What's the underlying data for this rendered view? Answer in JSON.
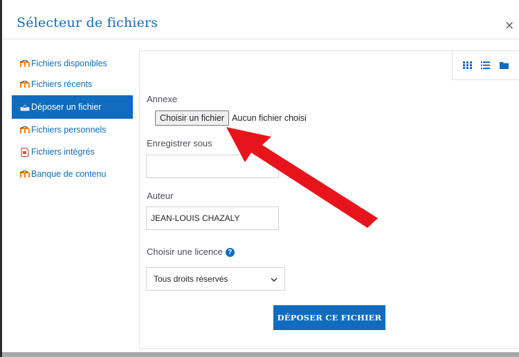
{
  "dialog": {
    "title": "Sélecteur de fichiers",
    "close_label": "×"
  },
  "sidebar": {
    "items": [
      {
        "label": "Fichiers disponibles",
        "icon": "moodle-icon",
        "active": false
      },
      {
        "label": "Fichiers récents",
        "icon": "moodle-icon",
        "active": false
      },
      {
        "label": "Déposer un fichier",
        "icon": "upload-icon",
        "active": true
      },
      {
        "label": "Fichiers personnels",
        "icon": "moodle-icon",
        "active": false
      },
      {
        "label": "Fichiers intégrés",
        "icon": "document-icon",
        "active": false
      },
      {
        "label": "Banque de contenu",
        "icon": "moodle-icon",
        "active": false
      }
    ]
  },
  "toolbar": {
    "views": [
      "grid-view-icon",
      "list-view-icon",
      "folder-view-icon"
    ]
  },
  "form": {
    "attachment_label": "Annexe",
    "choose_file_button": "Choisir un fichier",
    "no_file_text": "Aucun fichier choisi",
    "save_as_label": "Enregistrer sous",
    "save_as_value": "",
    "author_label": "Auteur",
    "author_value": "JEAN-LOUIS CHAZALY",
    "license_label": "Choisir une licence",
    "license_selected": "Tous droits réservés",
    "submit_label": "DÉPOSER CE FICHIER"
  },
  "colors": {
    "accent": "#0f6cbf",
    "annotation_arrow": "#e8141c"
  }
}
